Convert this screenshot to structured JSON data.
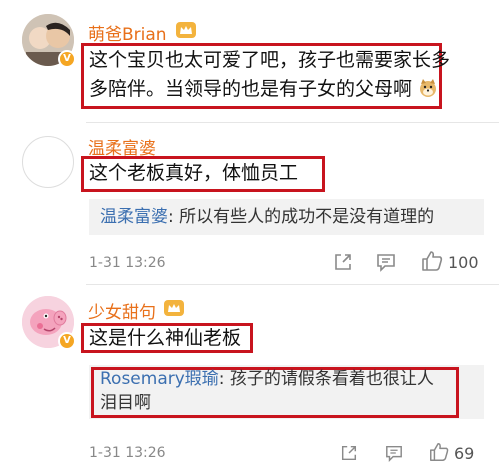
{
  "comments": [
    {
      "username": "萌爸Brian",
      "text_line1": "这个宝贝也太可爱了吧，孩子也需要家长多",
      "text_line2": "多陪伴。当领导的也是有子女的父母啊",
      "emoji": "doge-emoji"
    },
    {
      "username": "温柔富婆",
      "text_line1": "这个老板真好，体恤员工",
      "reply_author": "温柔富婆",
      "reply_text": ": 所以有些人的成功不是没有道理的",
      "timestamp": "1-31 13:26",
      "like_count": "100"
    },
    {
      "username": "少女甜句",
      "text_line1": "这是什么神仙老板",
      "reply_author": "Rosemary瑕瑜",
      "reply_text_line1": ": 孩子的请假条看着也很让人",
      "reply_text_line2": "泪目啊",
      "timestamp": "1-31 13:26",
      "like_count": "69"
    }
  ],
  "colors": {
    "username": "#e8701a",
    "highlight_box": "#c8141e",
    "reply_author": "#3b6fb0",
    "vip_badge": "#f5a623"
  },
  "icons": [
    "share-icon",
    "comment-icon",
    "like-icon",
    "crown-icon",
    "verified-icon"
  ]
}
